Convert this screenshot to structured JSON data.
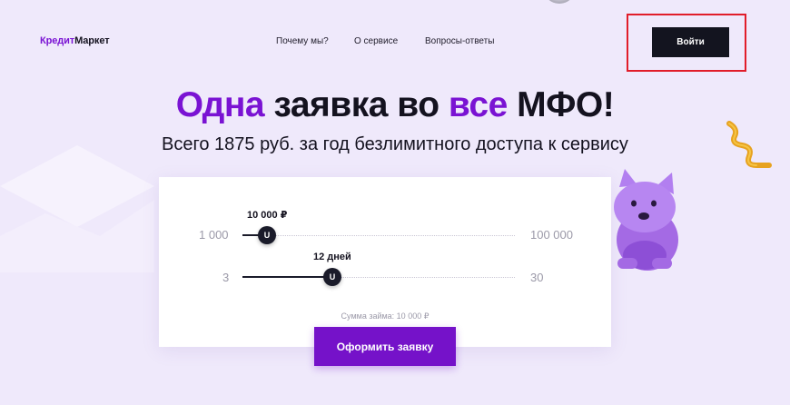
{
  "header": {
    "logo_part1": "Кредит",
    "logo_part2": "Маркет",
    "nav": [
      "Почему мы?",
      "О сервисе",
      "Вопросы-ответы"
    ],
    "login_label": "Войти"
  },
  "hero": {
    "title_part1": "Одна",
    "title_part2": " заявка во ",
    "title_part3": "все",
    "title_part4": " МФО!",
    "subtitle": "Всего 1875 руб. за год безлимитного доступа к сервису"
  },
  "calculator": {
    "amount": {
      "min_label": "1 000",
      "max_label": "100 000",
      "value_label": "10 000 ₽",
      "thumb_glyph": "U",
      "fraction": 0.09
    },
    "term": {
      "min_label": "3",
      "max_label": "30",
      "value_label": "12 дней",
      "thumb_glyph": "U",
      "fraction": 0.33
    },
    "sum_text": "Сумма займа: 10 000 ₽",
    "submit_label": "Оформить заявку"
  },
  "colors": {
    "accent": "#7a13d3",
    "dark": "#13141f",
    "background": "#efe9fb",
    "highlight_outline": "#e11d2a"
  },
  "icons": [
    "mascot-cat-illustration",
    "ribbon-decoration"
  ]
}
